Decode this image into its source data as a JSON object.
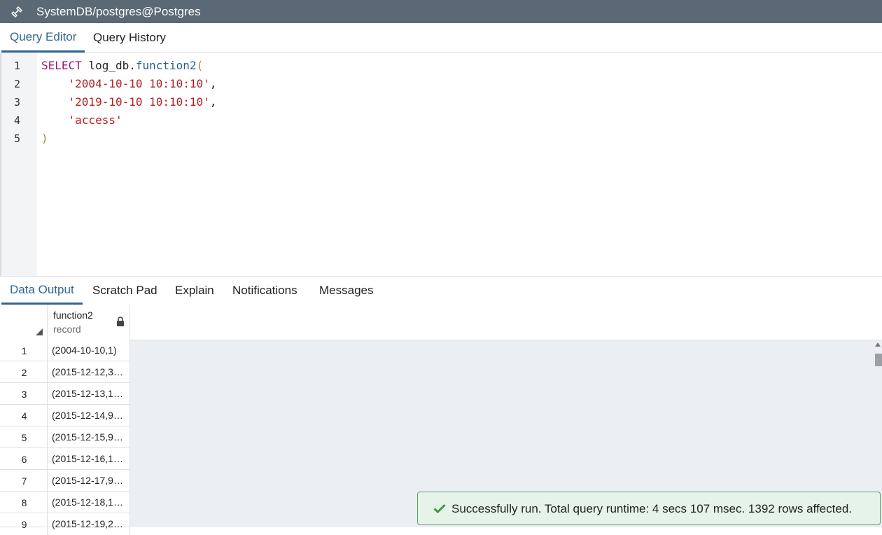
{
  "window": {
    "title": "SystemDB/postgres@Postgres"
  },
  "editor_tabs": [
    {
      "label": "Query Editor",
      "active": true
    },
    {
      "label": "Query History",
      "active": false
    }
  ],
  "editor": {
    "line_numbers": [
      "1",
      "2",
      "3",
      "4",
      "5"
    ],
    "lines": {
      "l1_keyword": "SELECT",
      "l1_schema": "log_db.",
      "l1_function": "function2",
      "l1_paren": "(",
      "l2_string": "'2004-10-10 10:10:10'",
      "l2_comma": ",",
      "l3_string": "'2019-10-10 10:10:10'",
      "l3_comma": ",",
      "l4_string": "'access'",
      "l5_paren": ")"
    }
  },
  "output_tabs": [
    {
      "label": "Data Output",
      "active": true
    },
    {
      "label": "Scratch Pad",
      "active": false
    },
    {
      "label": "Explain",
      "active": false
    },
    {
      "label": "Notifications",
      "active": false
    },
    {
      "label": "Messages",
      "active": false
    }
  ],
  "grid": {
    "column": {
      "name": "function2",
      "type": "record"
    },
    "rows": [
      {
        "n": "1",
        "value": "(2004-10-10,1)"
      },
      {
        "n": "2",
        "value": "(2015-12-12,3…"
      },
      {
        "n": "3",
        "value": "(2015-12-13,1…"
      },
      {
        "n": "4",
        "value": "(2015-12-14,9…"
      },
      {
        "n": "5",
        "value": "(2015-12-15,9…"
      },
      {
        "n": "6",
        "value": "(2015-12-16,1…"
      },
      {
        "n": "7",
        "value": "(2015-12-17,9…"
      },
      {
        "n": "8",
        "value": "(2015-12-18,1…"
      },
      {
        "n": "9",
        "value": "(2015-12-19,2…"
      }
    ]
  },
  "toast": {
    "message": "Successfully run. Total query runtime: 4 secs 107 msec. 1392 rows affected.",
    "icon": "check-icon",
    "color": "#3a9b45"
  },
  "colors": {
    "titlebar": "#5b6875",
    "accent": "#326690",
    "keyword": "#a0117e",
    "string": "#b61d1d"
  }
}
